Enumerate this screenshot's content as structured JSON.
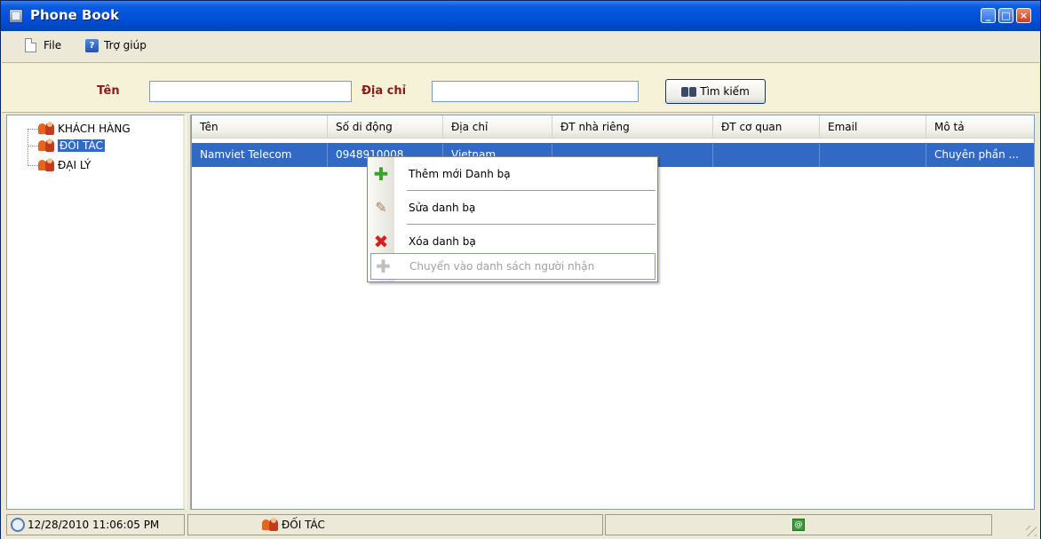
{
  "window": {
    "title": "Phone Book"
  },
  "menu": {
    "items": [
      {
        "label": "File",
        "icon": "file-icon"
      },
      {
        "label": "Trợ giúp",
        "icon": "help-icon"
      }
    ]
  },
  "search": {
    "name_label": "Tên",
    "name_value": "",
    "address_label": "Địa chỉ",
    "address_value": "",
    "button_label": "Tìm kiếm"
  },
  "tree": {
    "items": [
      {
        "label": "KHÁCH HÀNG",
        "selected": false
      },
      {
        "label": "ĐỐI TÁC",
        "selected": true
      },
      {
        "label": "ĐẠI LÝ",
        "selected": false
      }
    ]
  },
  "grid": {
    "columns": [
      "Tên",
      "Số di động",
      "Địa chỉ",
      "ĐT nhà riêng",
      "ĐT cơ quan",
      "Email",
      "Mô tả"
    ],
    "rows": [
      [
        "Namviet Telecom",
        "0948910008",
        "Vietnam",
        "",
        "",
        "",
        "Chuyên phần ..."
      ]
    ]
  },
  "context_menu": {
    "items": [
      {
        "label": "Thêm mới Danh bạ",
        "icon": "add-icon",
        "enabled": true
      },
      {
        "label": "Sửa danh bạ",
        "icon": "edit-icon",
        "enabled": true
      },
      {
        "label": "Xóa danh bạ",
        "icon": "delete-icon",
        "enabled": true
      },
      {
        "label": "Chuyển vào danh sách người nhận",
        "icon": "move-icon",
        "enabled": false
      }
    ]
  },
  "status": {
    "datetime": "12/28/2010 11:06:05 PM",
    "group": "ĐỐI TÁC"
  },
  "colors": {
    "title_bar": "#0050D8",
    "selection": "#316AC5",
    "label_red": "#8B1A1A",
    "search_panel_bg": "#F5F2D8"
  }
}
